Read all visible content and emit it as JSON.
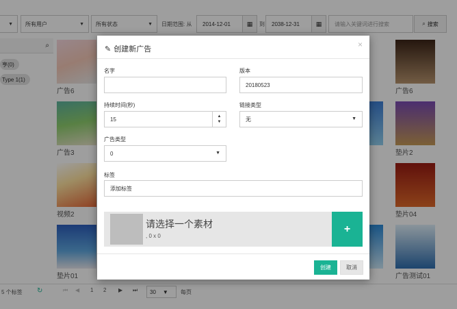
{
  "toolbar": {
    "user_filter": "所有用户",
    "status_filter": "所有状态",
    "date_label": "日期范围: 从",
    "date_from": "2014-12-01",
    "date_to_label": "到",
    "date_to": "2038-12-31",
    "search_placeholder": "请输入关键词进行搜索",
    "search_button": "搜索"
  },
  "sidebar": {
    "tags": [
      "亨(0)",
      "Type 1(1)"
    ]
  },
  "cards": [
    {
      "caption": "广告6"
    },
    {
      "caption": "广告3"
    },
    {
      "caption": "视频2"
    },
    {
      "caption": "垫片01"
    },
    {
      "caption": "广告6"
    },
    {
      "caption": "垫片2"
    },
    {
      "caption": "垫片04"
    },
    {
      "caption": "广告测试01"
    }
  ],
  "footer": {
    "tag_count": "5 个标签",
    "pages": [
      "1",
      "2"
    ],
    "page_size": "30",
    "per_page_label": "每页"
  },
  "modal": {
    "title": "创建新广告",
    "name_label": "名字",
    "name_value": "",
    "version_label": "版本",
    "version_value": "20180523",
    "duration_label": "持续时间(秒)",
    "duration_value": "15",
    "link_type_label": "链接类型",
    "link_type_value": "无",
    "ad_type_label": "广告类型",
    "ad_type_value": "0",
    "tags_label": "标签",
    "tags_placeholder": "添加标签",
    "asset_title": "请选择一个素材",
    "asset_dims": ", 0 x 0",
    "add_symbol": "+",
    "create_button": "创建",
    "cancel_button": "取消",
    "close_symbol": "×"
  },
  "colors": {
    "accent": "#1ab394",
    "overlay": "rgba(0,0,0,0.38)"
  }
}
